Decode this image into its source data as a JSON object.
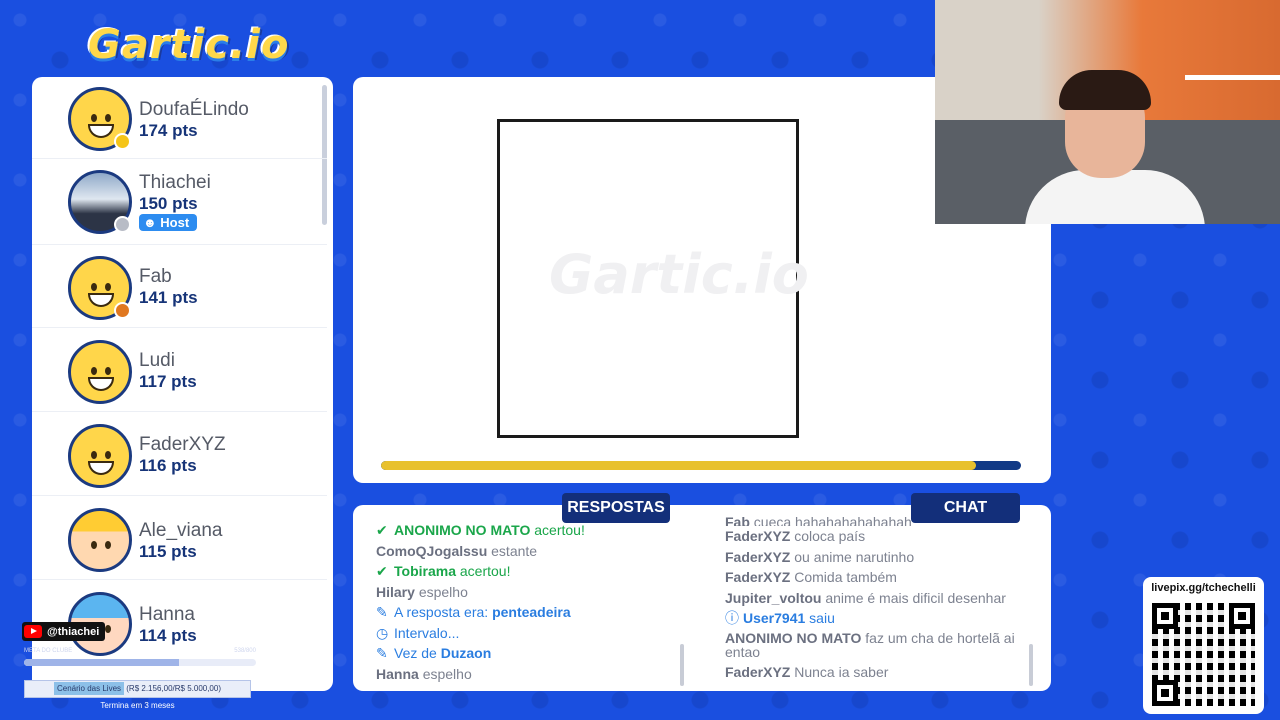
{
  "app": {
    "logo": "Gartic.io",
    "watermark": "Gartic.io"
  },
  "players": [
    {
      "name": "DoufaÉLindo",
      "points": "174 pts",
      "avatar": "yellow",
      "status_color": "#f5c518"
    },
    {
      "name": "Thiachei",
      "points": "150 pts",
      "avatar": "photo",
      "status_color": "#b8bcc6",
      "badge": "Host"
    },
    {
      "name": "Fab",
      "points": "141 pts",
      "avatar": "yellow",
      "status_color": "#e07820"
    },
    {
      "name": "Ludi",
      "points": "117 pts",
      "avatar": "yellow"
    },
    {
      "name": "FaderXYZ",
      "points": "116 pts",
      "avatar": "yellow"
    },
    {
      "name": "Ale_viana",
      "points": "115 pts",
      "avatar": "cap"
    },
    {
      "name": "Hanna",
      "points": "114 pts",
      "avatar": "blue"
    }
  ],
  "timer": {
    "progress": 0.93,
    "fill_color": "#e8c12e",
    "track_color": "#123a86"
  },
  "tabs": {
    "answers": "RESPOSTAS",
    "chat": "CHAT"
  },
  "answers": [
    {
      "icon": "check-icon",
      "name": "ANONIMO NO MATO",
      "text": "acertou!",
      "style": "correct"
    },
    {
      "name": "ComoQJogalssu",
      "text": "estante",
      "style": "guess"
    },
    {
      "icon": "check-icon",
      "name": "Tobirama",
      "text": "acertou!",
      "style": "correct"
    },
    {
      "name": "Hilary",
      "text": "espelho",
      "style": "guess"
    },
    {
      "icon": "pencil-icon",
      "text": "A resposta era:",
      "value": "penteadeira",
      "style": "info"
    },
    {
      "icon": "clock-icon",
      "text": "Intervalo...",
      "style": "info"
    },
    {
      "icon": "pencil-icon",
      "text": "Vez de",
      "value": "Duzaon",
      "style": "info"
    },
    {
      "name": "Hanna",
      "text": "espelho",
      "style": "guess"
    }
  ],
  "chat": [
    {
      "name": "Fab",
      "text": "cueca hahahahahahahah"
    },
    {
      "name": "FaderXYZ",
      "text": "coloca país"
    },
    {
      "name": "FaderXYZ",
      "text": "ou anime narutinho"
    },
    {
      "name": "FaderXYZ",
      "text": "Comida também"
    },
    {
      "name": "Jupiter_voltou",
      "text": "anime é mais dificil desenhar"
    },
    {
      "icon": "info-icon",
      "name": "User7941",
      "text": "saiu",
      "style": "system"
    },
    {
      "name": "ANONIMO NO MATO",
      "text": "faz um cha de hortelã ai entao"
    },
    {
      "name": "FaderXYZ",
      "text": "Nunca ia saber"
    }
  ],
  "qr": {
    "title": "livepix.gg/tchechelli"
  },
  "overlay": {
    "youtube_handle": "@thiachei",
    "goal_left": "META DO CLUBE",
    "goal_right": "538/800",
    "goal_progress": 0.67,
    "goal_label": "Cenário das Lives",
    "goal_value": "(R$ 2.156,00/R$ 5.000,00)",
    "goal_end": "Termina em 3 meses"
  }
}
